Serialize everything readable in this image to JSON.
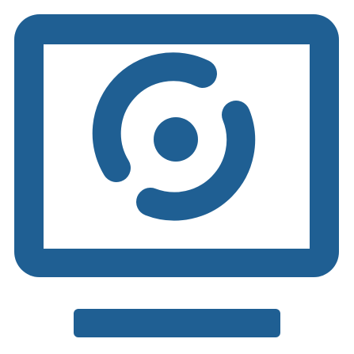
{
  "icon": {
    "name": "monitor-with-disc-icon",
    "color": "#1f5f93",
    "background": "#ffffff"
  }
}
